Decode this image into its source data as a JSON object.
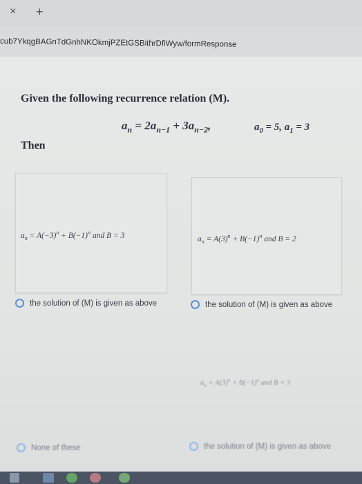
{
  "browser": {
    "tab_close_glyph": "×",
    "new_tab_glyph": "+",
    "url": "cub7YkqgBAGnTdGnhNKOkmjPZEtGSBithrDfiWyw/formResponse"
  },
  "question": {
    "intro": "Given the following recurrence relation (M).",
    "recurrence_lhs": "a",
    "recurrence_lhs_sub": "n",
    "recurrence_rhs_eq": " = 2a",
    "recurrence_sub1": "n−1",
    "recurrence_mid": " + 3a",
    "recurrence_sub2": "n−2",
    "recurrence_tail": ",",
    "init_a": "a",
    "init_a_sub": "0",
    "init_eq": " = 5, a",
    "init_b_sub": "1",
    "init_tail": " = 3",
    "then": "Then"
  },
  "options": [
    {
      "expr_pre": "a",
      "expr_sub": "n",
      "expr_mid": " = A(−3)",
      "expr_sup1": "n",
      "expr_mid2": " + B(−1)",
      "expr_sup2": "n",
      "expr_tail": " and B = 3",
      "label": "the solution of (M) is given as above"
    },
    {
      "expr_pre": "a",
      "expr_sub": "n",
      "expr_mid": " = A(3)",
      "expr_sup1": "n",
      "expr_mid2": " + B(−1)",
      "expr_sup2": "n",
      "expr_tail": " and B = 2",
      "label": "the solution of (M) is given as above"
    },
    {
      "label": "None of these"
    },
    {
      "expr_pre": "a",
      "expr_sub": "n",
      "expr_mid": " = A(3)",
      "expr_sup1": "n",
      "expr_mid2": " + B(−1)",
      "expr_sup2": "n",
      "expr_tail": " and B = 3",
      "label": "the solution of (M) is given as above"
    }
  ],
  "colors": {
    "radio_border": "#5e8fd8",
    "page_bg": "#e6e8e7",
    "text": "#2a2f3b"
  }
}
